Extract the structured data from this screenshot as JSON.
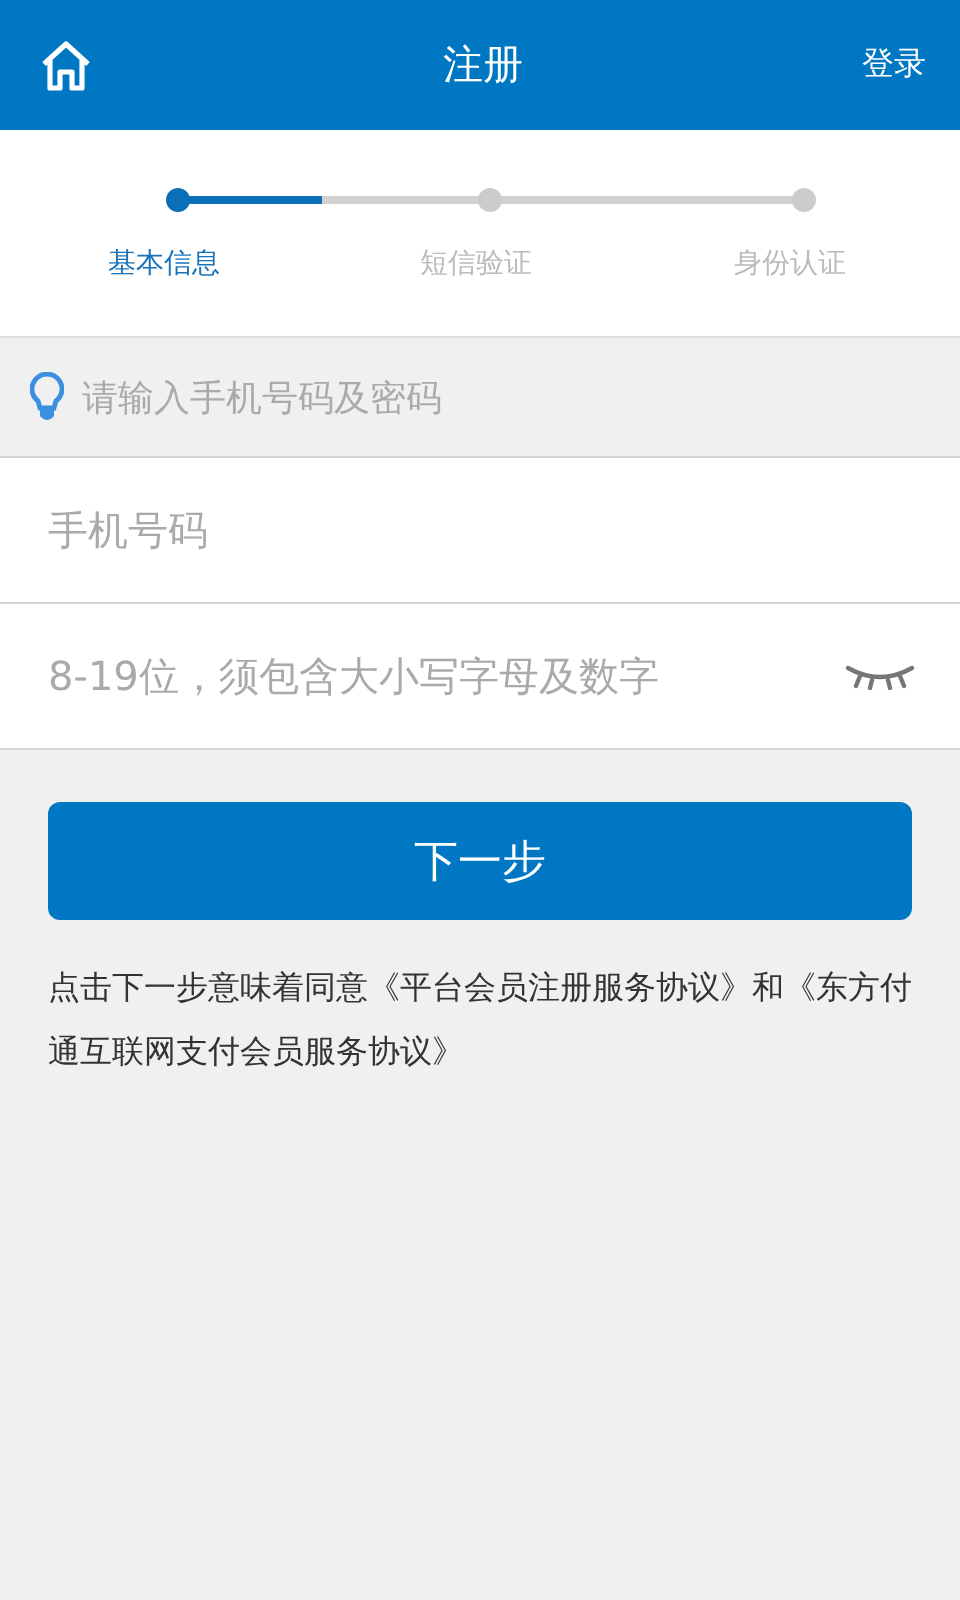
{
  "header": {
    "title": "注册",
    "action": "登录"
  },
  "steps": {
    "level": 0.23,
    "items": [
      {
        "label": "基本信息",
        "selected": true
      },
      {
        "label": "短信验证",
        "selected": false
      },
      {
        "label": "身份认证",
        "selected": false
      }
    ]
  },
  "hint": "请输入手机号码及密码",
  "fields": [
    {
      "kind": "phone",
      "placeholder": "手机号码"
    },
    {
      "kind": "password",
      "placeholder": "8-19位，须包含大小写字母及数字"
    }
  ],
  "button": "下一步",
  "agreement": "点击下一步意味着同意《平台会员注册服务协议》和《东方付通互联网支付会员服务协议》"
}
